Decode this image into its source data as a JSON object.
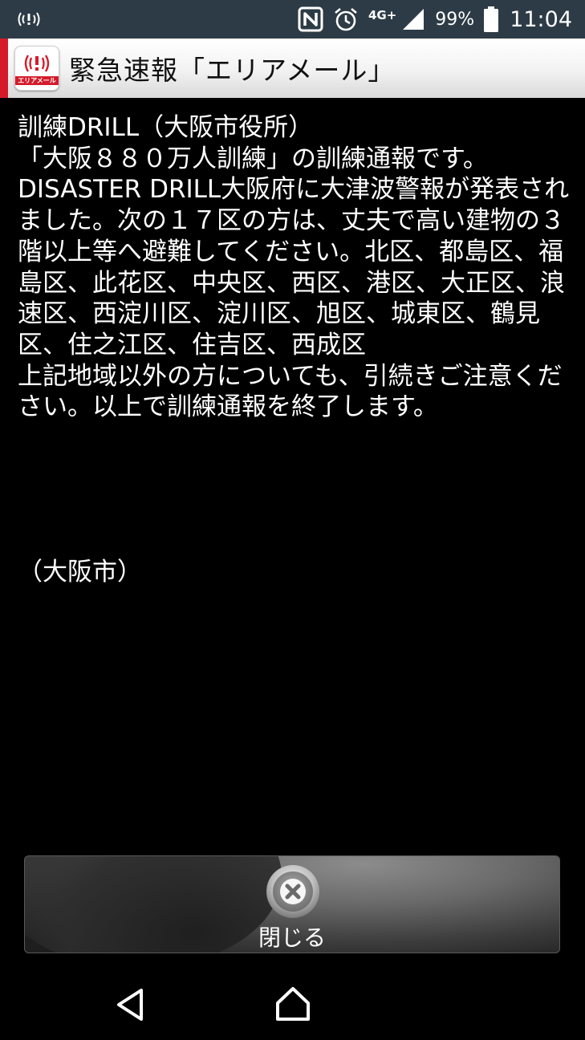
{
  "status_bar": {
    "network_type": "4G+",
    "battery_percent": "99%",
    "time": "11:04",
    "icons": [
      "emergency-broadcast-icon",
      "nfc-icon",
      "alarm-icon",
      "signal-icon",
      "battery-icon"
    ]
  },
  "title_bar": {
    "app_icon_label": "エリアメール",
    "title": "緊急速報「エリアメール」",
    "accent_color": "#d51b2b"
  },
  "message": {
    "body": "訓練DRILL（大阪市役所）\n「大阪８８０万人訓練」の訓練通報です。DISASTER DRILL大阪府に大津波警報が発表されました。次の１７区の方は、丈夫で高い建物の３階以上等へ避難してください。北区、都島区、福島区、此花区、中央区、西区、港区、大正区、浪速区、西淀川区、淀川区、旭区、城東区、鶴見区、住之江区、住吉区、西成区\n上記地域以外の方についても、引続きご注意ください。以上で訓練通報を終了します。",
    "sender": "（大阪市）"
  },
  "close_button": {
    "label": "閉じる",
    "icon": "close-icon"
  },
  "nav_bar": {
    "icons": [
      "back-icon",
      "home-icon"
    ]
  }
}
